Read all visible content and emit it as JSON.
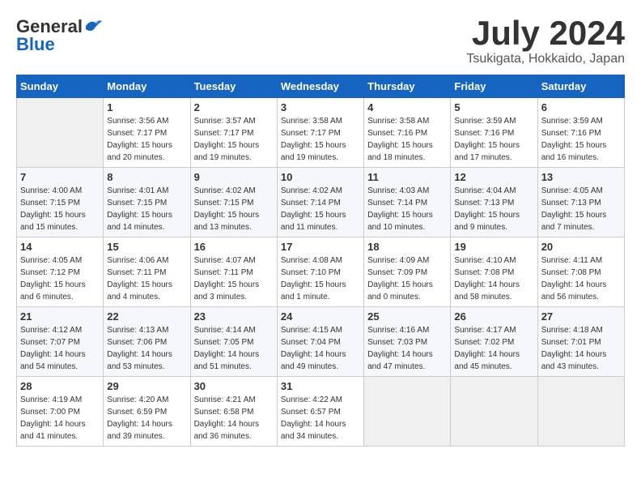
{
  "header": {
    "logo_general": "General",
    "logo_blue": "Blue",
    "month_title": "July 2024",
    "location": "Tsukigata, Hokkaido, Japan"
  },
  "days_of_week": [
    "Sunday",
    "Monday",
    "Tuesday",
    "Wednesday",
    "Thursday",
    "Friday",
    "Saturday"
  ],
  "weeks": [
    [
      {
        "day": "",
        "sunrise": "",
        "sunset": "",
        "daylight": ""
      },
      {
        "day": "1",
        "sunrise": "Sunrise: 3:56 AM",
        "sunset": "Sunset: 7:17 PM",
        "daylight": "Daylight: 15 hours and 20 minutes."
      },
      {
        "day": "2",
        "sunrise": "Sunrise: 3:57 AM",
        "sunset": "Sunset: 7:17 PM",
        "daylight": "Daylight: 15 hours and 19 minutes."
      },
      {
        "day": "3",
        "sunrise": "Sunrise: 3:58 AM",
        "sunset": "Sunset: 7:17 PM",
        "daylight": "Daylight: 15 hours and 19 minutes."
      },
      {
        "day": "4",
        "sunrise": "Sunrise: 3:58 AM",
        "sunset": "Sunset: 7:16 PM",
        "daylight": "Daylight: 15 hours and 18 minutes."
      },
      {
        "day": "5",
        "sunrise": "Sunrise: 3:59 AM",
        "sunset": "Sunset: 7:16 PM",
        "daylight": "Daylight: 15 hours and 17 minutes."
      },
      {
        "day": "6",
        "sunrise": "Sunrise: 3:59 AM",
        "sunset": "Sunset: 7:16 PM",
        "daylight": "Daylight: 15 hours and 16 minutes."
      }
    ],
    [
      {
        "day": "7",
        "sunrise": "Sunrise: 4:00 AM",
        "sunset": "Sunset: 7:15 PM",
        "daylight": "Daylight: 15 hours and 15 minutes."
      },
      {
        "day": "8",
        "sunrise": "Sunrise: 4:01 AM",
        "sunset": "Sunset: 7:15 PM",
        "daylight": "Daylight: 15 hours and 14 minutes."
      },
      {
        "day": "9",
        "sunrise": "Sunrise: 4:02 AM",
        "sunset": "Sunset: 7:15 PM",
        "daylight": "Daylight: 15 hours and 13 minutes."
      },
      {
        "day": "10",
        "sunrise": "Sunrise: 4:02 AM",
        "sunset": "Sunset: 7:14 PM",
        "daylight": "Daylight: 15 hours and 11 minutes."
      },
      {
        "day": "11",
        "sunrise": "Sunrise: 4:03 AM",
        "sunset": "Sunset: 7:14 PM",
        "daylight": "Daylight: 15 hours and 10 minutes."
      },
      {
        "day": "12",
        "sunrise": "Sunrise: 4:04 AM",
        "sunset": "Sunset: 7:13 PM",
        "daylight": "Daylight: 15 hours and 9 minutes."
      },
      {
        "day": "13",
        "sunrise": "Sunrise: 4:05 AM",
        "sunset": "Sunset: 7:13 PM",
        "daylight": "Daylight: 15 hours and 7 minutes."
      }
    ],
    [
      {
        "day": "14",
        "sunrise": "Sunrise: 4:05 AM",
        "sunset": "Sunset: 7:12 PM",
        "daylight": "Daylight: 15 hours and 6 minutes."
      },
      {
        "day": "15",
        "sunrise": "Sunrise: 4:06 AM",
        "sunset": "Sunset: 7:11 PM",
        "daylight": "Daylight: 15 hours and 4 minutes."
      },
      {
        "day": "16",
        "sunrise": "Sunrise: 4:07 AM",
        "sunset": "Sunset: 7:11 PM",
        "daylight": "Daylight: 15 hours and 3 minutes."
      },
      {
        "day": "17",
        "sunrise": "Sunrise: 4:08 AM",
        "sunset": "Sunset: 7:10 PM",
        "daylight": "Daylight: 15 hours and 1 minute."
      },
      {
        "day": "18",
        "sunrise": "Sunrise: 4:09 AM",
        "sunset": "Sunset: 7:09 PM",
        "daylight": "Daylight: 15 hours and 0 minutes."
      },
      {
        "day": "19",
        "sunrise": "Sunrise: 4:10 AM",
        "sunset": "Sunset: 7:08 PM",
        "daylight": "Daylight: 14 hours and 58 minutes."
      },
      {
        "day": "20",
        "sunrise": "Sunrise: 4:11 AM",
        "sunset": "Sunset: 7:08 PM",
        "daylight": "Daylight: 14 hours and 56 minutes."
      }
    ],
    [
      {
        "day": "21",
        "sunrise": "Sunrise: 4:12 AM",
        "sunset": "Sunset: 7:07 PM",
        "daylight": "Daylight: 14 hours and 54 minutes."
      },
      {
        "day": "22",
        "sunrise": "Sunrise: 4:13 AM",
        "sunset": "Sunset: 7:06 PM",
        "daylight": "Daylight: 14 hours and 53 minutes."
      },
      {
        "day": "23",
        "sunrise": "Sunrise: 4:14 AM",
        "sunset": "Sunset: 7:05 PM",
        "daylight": "Daylight: 14 hours and 51 minutes."
      },
      {
        "day": "24",
        "sunrise": "Sunrise: 4:15 AM",
        "sunset": "Sunset: 7:04 PM",
        "daylight": "Daylight: 14 hours and 49 minutes."
      },
      {
        "day": "25",
        "sunrise": "Sunrise: 4:16 AM",
        "sunset": "Sunset: 7:03 PM",
        "daylight": "Daylight: 14 hours and 47 minutes."
      },
      {
        "day": "26",
        "sunrise": "Sunrise: 4:17 AM",
        "sunset": "Sunset: 7:02 PM",
        "daylight": "Daylight: 14 hours and 45 minutes."
      },
      {
        "day": "27",
        "sunrise": "Sunrise: 4:18 AM",
        "sunset": "Sunset: 7:01 PM",
        "daylight": "Daylight: 14 hours and 43 minutes."
      }
    ],
    [
      {
        "day": "28",
        "sunrise": "Sunrise: 4:19 AM",
        "sunset": "Sunset: 7:00 PM",
        "daylight": "Daylight: 14 hours and 41 minutes."
      },
      {
        "day": "29",
        "sunrise": "Sunrise: 4:20 AM",
        "sunset": "Sunset: 6:59 PM",
        "daylight": "Daylight: 14 hours and 39 minutes."
      },
      {
        "day": "30",
        "sunrise": "Sunrise: 4:21 AM",
        "sunset": "Sunset: 6:58 PM",
        "daylight": "Daylight: 14 hours and 36 minutes."
      },
      {
        "day": "31",
        "sunrise": "Sunrise: 4:22 AM",
        "sunset": "Sunset: 6:57 PM",
        "daylight": "Daylight: 14 hours and 34 minutes."
      },
      {
        "day": "",
        "sunrise": "",
        "sunset": "",
        "daylight": ""
      },
      {
        "day": "",
        "sunrise": "",
        "sunset": "",
        "daylight": ""
      },
      {
        "day": "",
        "sunrise": "",
        "sunset": "",
        "daylight": ""
      }
    ]
  ]
}
